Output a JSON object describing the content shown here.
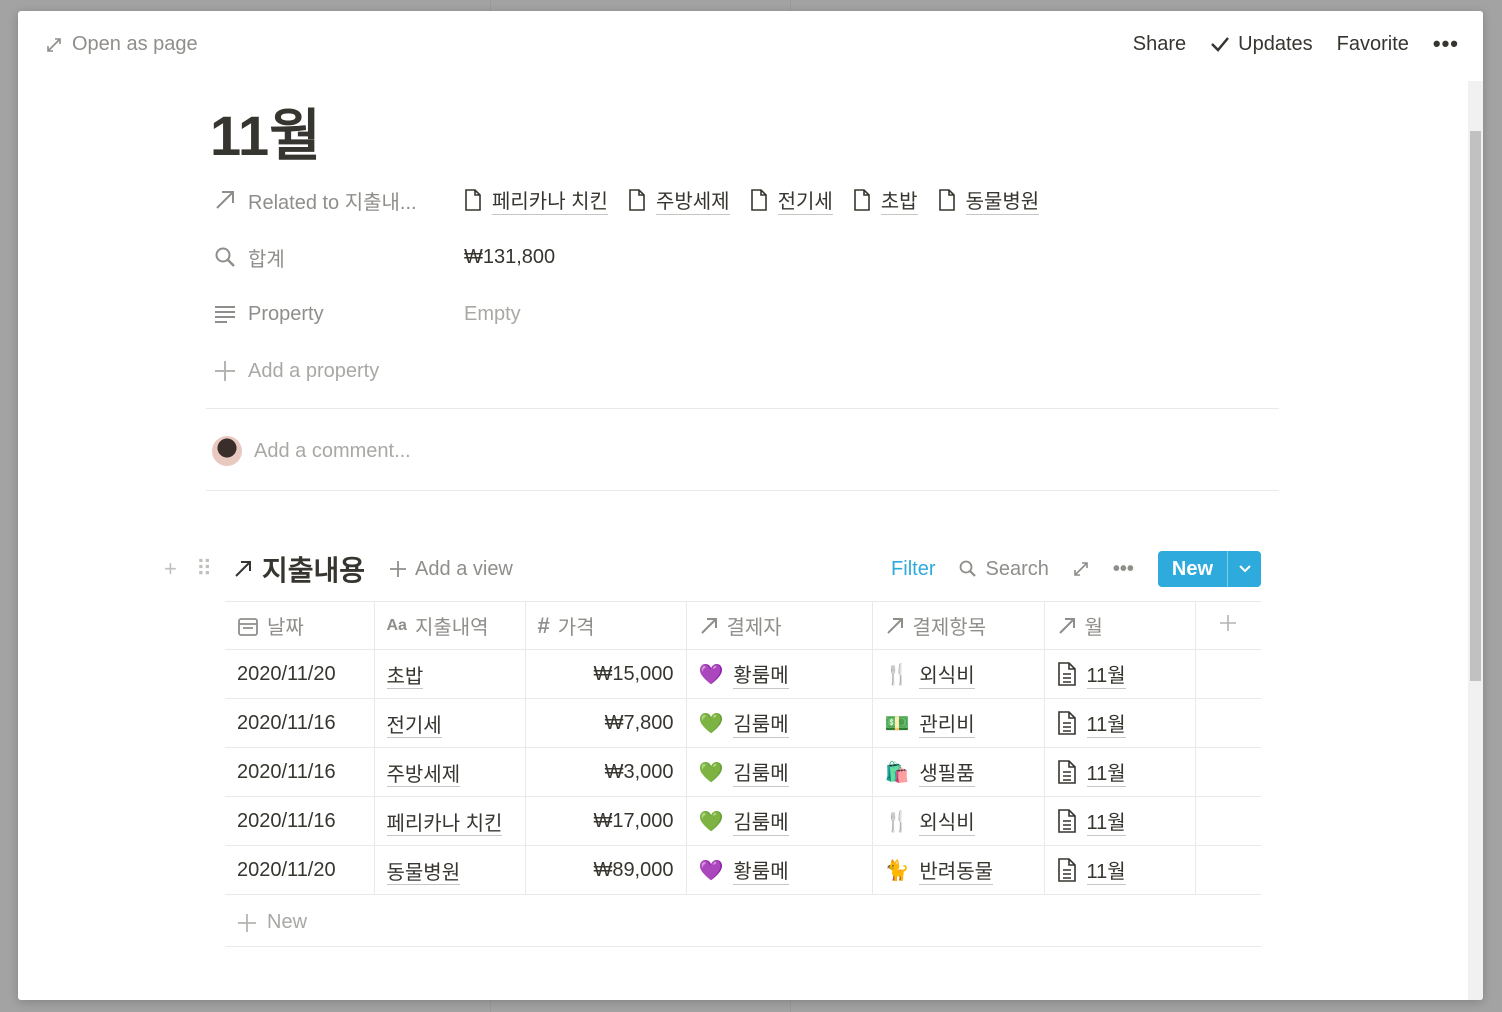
{
  "topbar": {
    "open_as_page": "Open as page",
    "share": "Share",
    "updates": "Updates",
    "favorite": "Favorite",
    "more": "•••"
  },
  "page": {
    "title": "11월"
  },
  "properties": {
    "related": {
      "label": "Related to 지출내...",
      "items": [
        "페리카나 치킨",
        "주방세제",
        "전기세",
        "초밥",
        "동물병원"
      ]
    },
    "sum": {
      "label": "합계",
      "value": "₩131,800"
    },
    "property": {
      "label": "Property",
      "value": "Empty"
    },
    "add": "Add a property"
  },
  "comment": {
    "placeholder": "Add a comment..."
  },
  "database": {
    "title": "지출내용",
    "add_view": "Add a view",
    "filter": "Filter",
    "search": "Search",
    "more": "•••",
    "new_button": "New",
    "columns": [
      "날짜",
      "지출내역",
      "가격",
      "결제자",
      "결제항목",
      "월"
    ],
    "rows": [
      {
        "date": "2020/11/20",
        "item": "초밥",
        "price": "₩15,000",
        "payer": "황룸메",
        "payer_icon": "💜",
        "category": "외식비",
        "category_icon": "🍴",
        "month": "11월"
      },
      {
        "date": "2020/11/16",
        "item": "전기세",
        "price": "₩7,800",
        "payer": "김룸메",
        "payer_icon": "💚",
        "category": "관리비",
        "category_icon": "💵",
        "month": "11월"
      },
      {
        "date": "2020/11/16",
        "item": "주방세제",
        "price": "₩3,000",
        "payer": "김룸메",
        "payer_icon": "💚",
        "category": "생필품",
        "category_icon": "🛍️",
        "month": "11월"
      },
      {
        "date": "2020/11/16",
        "item": "페리카나 치킨",
        "price": "₩17,000",
        "payer": "김룸메",
        "payer_icon": "💚",
        "category": "외식비",
        "category_icon": "🍴",
        "month": "11월"
      },
      {
        "date": "2020/11/20",
        "item": "동물병원",
        "price": "₩89,000",
        "payer": "황룸메",
        "payer_icon": "💜",
        "category": "반려동물",
        "category_icon": "🐈",
        "month": "11월"
      }
    ],
    "new_row": "New"
  },
  "colors": {
    "accent": "#2eaadc",
    "text": "#37352f",
    "muted": "#8f8e8a"
  }
}
